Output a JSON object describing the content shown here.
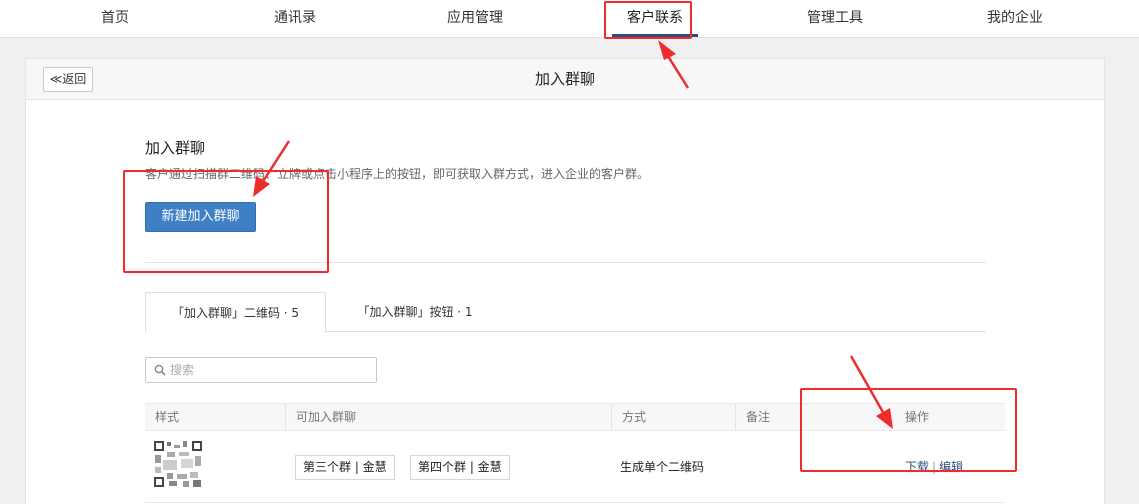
{
  "nav": {
    "items": [
      {
        "label": "首页"
      },
      {
        "label": "通讯录"
      },
      {
        "label": "应用管理"
      },
      {
        "label": "客户联系"
      },
      {
        "label": "管理工具"
      },
      {
        "label": "我的企业"
      }
    ],
    "active_index": 3
  },
  "header": {
    "back_label": "≪返回",
    "title": "加入群聊"
  },
  "section": {
    "title": "加入群聊",
    "description": "客户通过扫描群二维码、立牌或点击小程序上的按钮，即可获取入群方式，进入企业的客户群。",
    "new_button": "新建加入群聊"
  },
  "tabs": [
    {
      "label": "「加入群聊」二维码 · 5",
      "active": true
    },
    {
      "label": "「加入群聊」按钮 · 1",
      "active": false
    }
  ],
  "search": {
    "placeholder": "搜索",
    "value": ""
  },
  "table": {
    "columns": [
      "样式",
      "可加入群聊",
      "方式",
      "备注",
      "操作"
    ],
    "rows": [
      {
        "groups": [
          "第三个群 | 金慧",
          "第四个群 | 金慧"
        ],
        "method": "生成单个二维码",
        "note": "",
        "actions": {
          "download": "下载",
          "separator": "|",
          "edit": "编辑"
        }
      }
    ]
  },
  "colors": {
    "accent": "#3f7fc4",
    "nav_active": "#2b4f7e",
    "annotation": "#ee2c2c"
  }
}
